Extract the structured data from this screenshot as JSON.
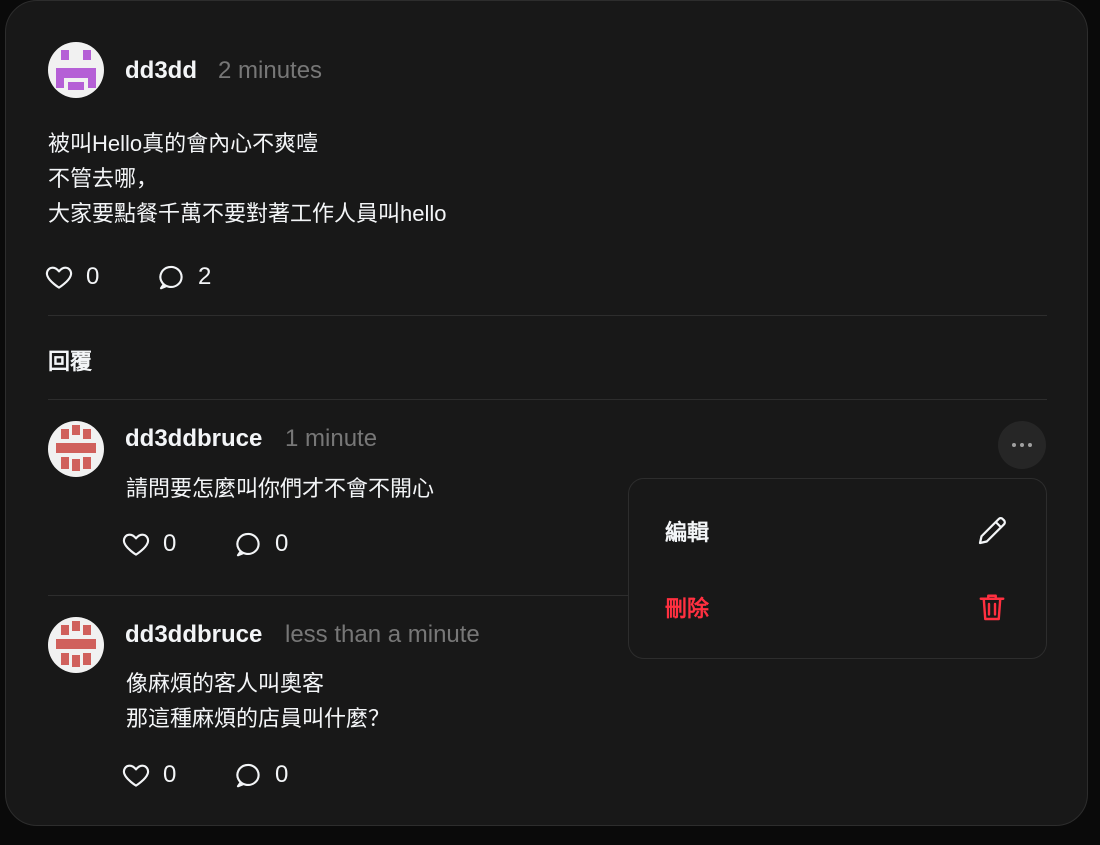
{
  "post": {
    "username": "dd3dd",
    "time": "2 minutes",
    "lines": [
      "被叫Hello真的會內心不爽噎",
      "不管去哪，",
      "大家要點餐千萬不要對著工作人員叫hello"
    ],
    "likes": "0",
    "comments": "2"
  },
  "replies_title": "回覆",
  "replies": [
    {
      "username": "dd3ddbruce",
      "time": "1 minute",
      "lines": [
        "請問要怎麼叫你們才不會不開心"
      ],
      "likes": "0",
      "comments": "0"
    },
    {
      "username": "dd3ddbruce",
      "time": "less than a minute",
      "lines": [
        "像麻煩的客人叫奧客",
        "那這種麻煩的店員叫什麼？"
      ],
      "likes": "0",
      "comments": "0"
    }
  ],
  "menu": {
    "edit_label": "編輯",
    "delete_label": "刪除",
    "edit_icon": "pencil-icon",
    "delete_icon": "trash-icon"
  },
  "colors": {
    "background": "#181818",
    "danger": "#ff3040",
    "muted": "#777777",
    "avatar_purple": "#b55fd6",
    "avatar_red": "#d0605c"
  }
}
